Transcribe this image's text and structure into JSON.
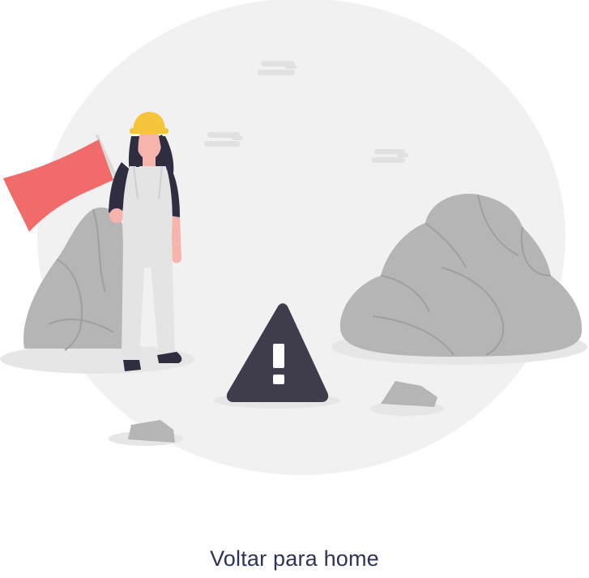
{
  "error_page": {
    "illustration": {
      "icon": "warning-triangle-icon",
      "description_icons": [
        "worker-with-flag",
        "rocks",
        "clouds"
      ],
      "colors": {
        "background_circle": "#f1f1f1",
        "rock": "#b5b5b5",
        "rock_dark": "#a3a3a3",
        "warning": "#3f3d4b",
        "flag": "#f26b6b",
        "helmet": "#f7c53b",
        "skin": "#f6b4ad",
        "hair": "#2f2e41"
      }
    },
    "home_link_label": "Voltar para home",
    "home_link_color": "#2e3358"
  }
}
